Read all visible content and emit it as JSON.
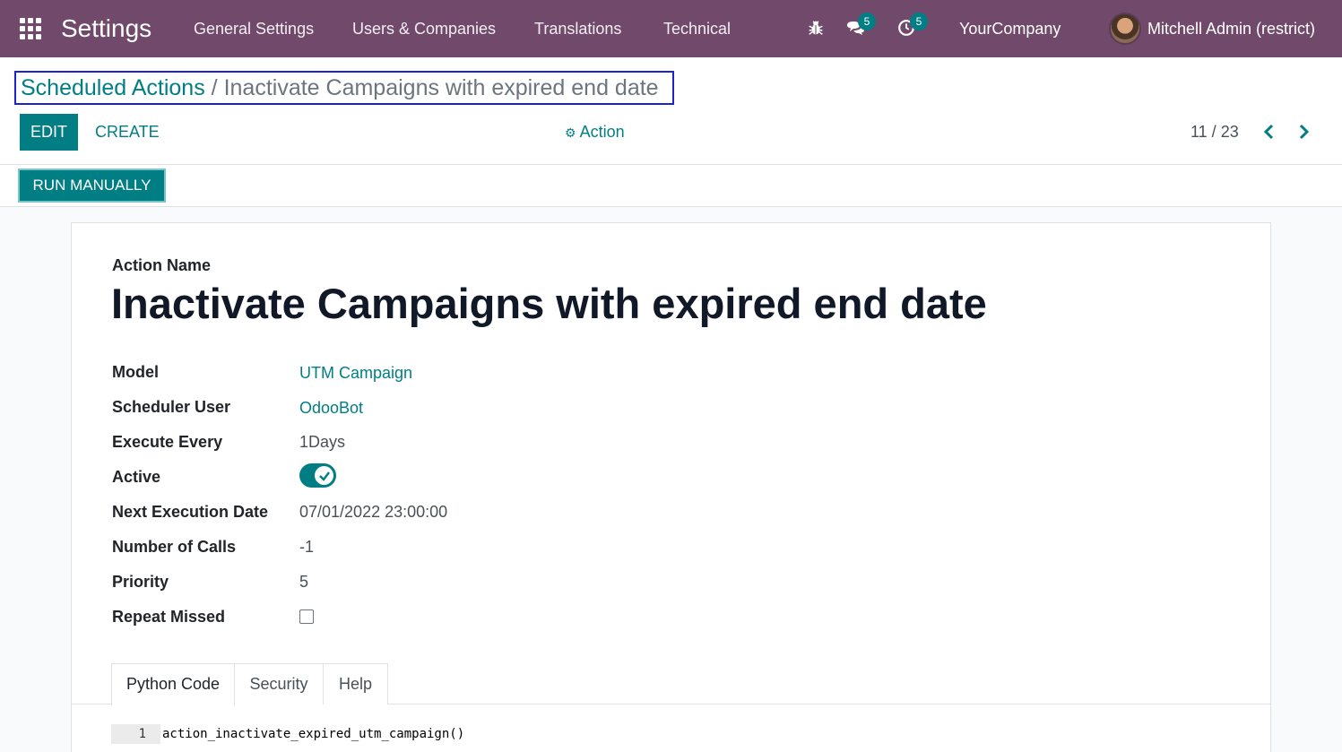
{
  "navbar": {
    "app_name": "Settings",
    "menu": [
      "General Settings",
      "Users & Companies",
      "Translations",
      "Technical"
    ],
    "messages_count": "5",
    "activities_count": "5",
    "company": "YourCompany",
    "user": "Mitchell Admin (restrict)"
  },
  "breadcrumb": {
    "parent": "Scheduled Actions",
    "separator": "/",
    "current": "Inactivate Campaigns with expired end date"
  },
  "control_panel": {
    "edit_label": "EDIT",
    "create_label": "CREATE",
    "action_label": "Action",
    "pager": "11 / 23"
  },
  "header": {
    "run_label": "RUN MANUALLY"
  },
  "form": {
    "name_label": "Action Name",
    "name": "Inactivate Campaigns with expired end date",
    "fields": {
      "model": {
        "label": "Model",
        "value": "UTM Campaign"
      },
      "user": {
        "label": "Scheduler User",
        "value": "OdooBot"
      },
      "interval": {
        "label": "Execute Every",
        "value": "1Days"
      },
      "active": {
        "label": "Active",
        "value": true
      },
      "nextcall": {
        "label": "Next Execution Date",
        "value": "07/01/2022 23:00:00"
      },
      "numbercall": {
        "label": "Number of Calls",
        "value": "-1"
      },
      "priority": {
        "label": "Priority",
        "value": "5"
      },
      "doall": {
        "label": "Repeat Missed",
        "value": false
      }
    },
    "tabs": [
      "Python Code",
      "Security",
      "Help"
    ],
    "active_tab": "Python Code",
    "code": {
      "line_number": "1",
      "line": "action_inactivate_expired_utm_campaign()"
    }
  },
  "colors": {
    "navbar": "#71496b",
    "primary": "#017e84",
    "highlight_border": "#1d22cf"
  }
}
